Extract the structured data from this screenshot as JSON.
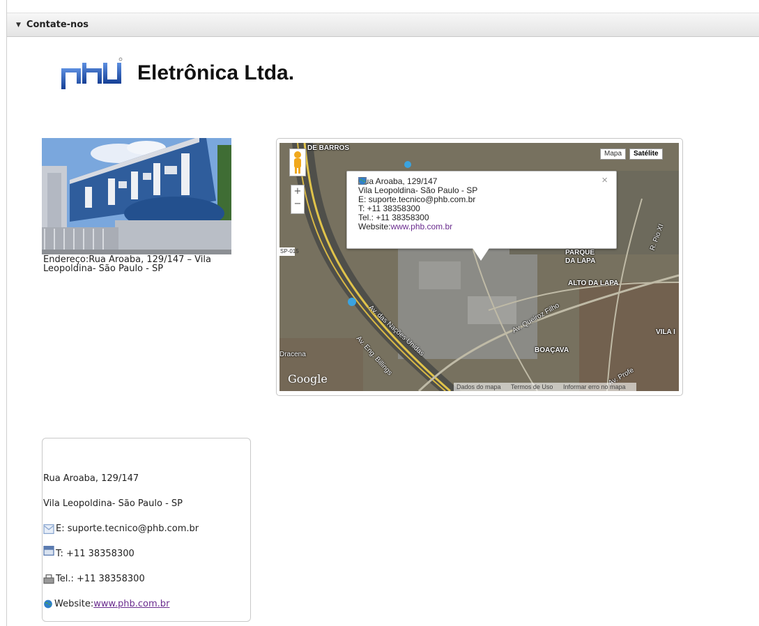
{
  "portlet": {
    "title": "Contate-nos"
  },
  "company": {
    "name": "Eletrônica Ltda.",
    "brand_color": "#1d4fa8"
  },
  "photo": {
    "caption": "Endereço:Rua Aroaba, 129/147 – Vila Leopoldina- São Paulo - SP"
  },
  "map": {
    "type_buttons": [
      "Mapa",
      "Satélite"
    ],
    "selected_type": "Satélite",
    "labels": {
      "top_left": "DE BARROS",
      "parque": "PARQUE",
      "dalapa": "DA LAPA",
      "alto": "ALTO DA LAPA",
      "boacava": "BOAÇAVA",
      "vila": "VILA I",
      "queiroz": "Av. Queiroz Filho",
      "nacoes": "Av. das Nações Unidas",
      "billings": "Av. Eng. Billings",
      "pioxi": "R. Pio XI",
      "profe": "Av. Profe",
      "dracena": "Dracena",
      "sp015": "SP-015"
    },
    "google": "Google",
    "footer": [
      "Dados do mapa",
      "Termos de Uso",
      "Informar erro no mapa"
    ],
    "infowindow": {
      "address1": "Rua Aroaba, 129/147",
      "address2": "Vila Leopoldina- São Paulo - SP",
      "email": "E: suporte.tecnico@phb.com.br",
      "phone": "T: +11 38358300",
      "tel": "Tel.: +11 38358300",
      "website_label": "Website:",
      "website_url": "www.phb.com.br",
      "close": "×"
    }
  },
  "card": {
    "address1": "Rua Aroaba, 129/147",
    "address2": "Vila Leopoldina- São Paulo - SP",
    "email": "E: suporte.tecnico@phb.com.br",
    "phone": "T: +11 38358300",
    "tel": "Tel.: +11 38358300",
    "website_label": "Website:",
    "website_url": "www.phb.com.br"
  },
  "icons": {
    "email": "email-icon",
    "phone": "phone-icon",
    "fax": "fax-icon",
    "globe": "globe-icon"
  }
}
